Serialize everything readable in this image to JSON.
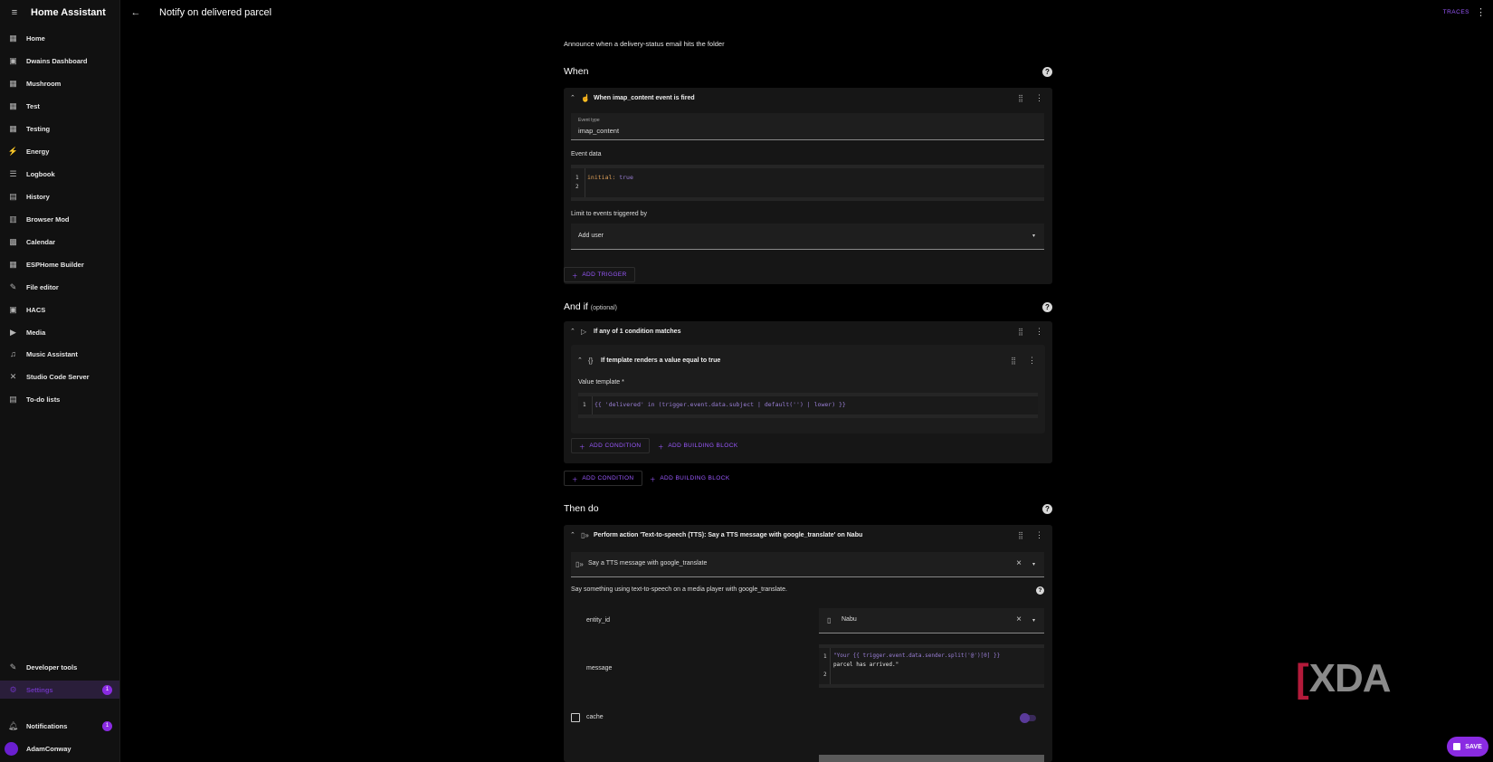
{
  "app": {
    "title": "Home Assistant"
  },
  "sidebar": {
    "items": [
      {
        "label": "Home",
        "icon": "grid-icon"
      },
      {
        "label": "Dwains Dashboard",
        "icon": "dashboard-icon"
      },
      {
        "label": "Mushroom",
        "icon": "grid-icon"
      },
      {
        "label": "Test",
        "icon": "grid-icon"
      },
      {
        "label": "Testing",
        "icon": "grid-icon"
      },
      {
        "label": "Energy",
        "icon": "lightning-icon"
      },
      {
        "label": "Logbook",
        "icon": "list-icon"
      },
      {
        "label": "History",
        "icon": "chart-icon"
      },
      {
        "label": "Browser Mod",
        "icon": "browser-icon"
      },
      {
        "label": "Calendar",
        "icon": "calendar-icon"
      },
      {
        "label": "ESPHome Builder",
        "icon": "esphome-icon"
      },
      {
        "label": "File editor",
        "icon": "wrench-icon"
      },
      {
        "label": "HACS",
        "icon": "hacs-icon"
      },
      {
        "label": "Media",
        "icon": "media-icon"
      },
      {
        "label": "Music Assistant",
        "icon": "music-icon"
      },
      {
        "label": "Studio Code Server",
        "icon": "vscode-icon"
      },
      {
        "label": "To-do lists",
        "icon": "clipboard-icon"
      }
    ],
    "developer_tools": "Developer tools",
    "settings": "Settings",
    "settings_badge": "1",
    "notifications": "Notifications",
    "notifications_badge": "1",
    "user": "AdamConway"
  },
  "topbar": {
    "title": "Notify on delivered parcel",
    "traces": "TRACES"
  },
  "automation": {
    "description": "Announce when a delivery-status email hits the folder",
    "when": {
      "title": "When",
      "trigger_header": "When imap_content event is fired",
      "event_type_label": "Event type",
      "event_type_value": "imap_content",
      "event_data_label": "Event data",
      "event_data_line1_key": "initial:",
      "event_data_line1_val": "true",
      "limit_label": "Limit to events triggered by",
      "add_user": "Add user",
      "add_trigger": "ADD TRIGGER"
    },
    "and_if": {
      "title": "And if",
      "optional": "(optional)",
      "condition_header": "If any of 1 condition matches",
      "template_header": "If template renders a value equal to true",
      "value_template_label": "Value template *",
      "template_code": "{{ 'delivered' in (trigger.event.data.subject | default('') | lower) }}",
      "inner_add_condition": "ADD CONDITION",
      "inner_add_building_block": "ADD BUILDING BLOCK",
      "add_condition": "ADD CONDITION",
      "add_building_block": "ADD BUILDING BLOCK"
    },
    "then_do": {
      "title": "Then do",
      "action_header": "Perform action 'Text-to-speech (TTS): Say a TTS message with google_translate' on Nabu",
      "action_select": "Say a TTS message with google_translate",
      "action_description": "Say something using text-to-speech on a media player with google_translate.",
      "entity_id_label": "entity_id",
      "entity_value": "Nabu",
      "message_label": "message",
      "message_line1": "\"Your {{ trigger.event.data.sender.split('@')[0] }}",
      "message_line1b": "parcel has arrived.\"",
      "cache_label": "cache"
    }
  },
  "save_label": "SAVE",
  "line_numbers": {
    "one": "1",
    "two": "2"
  },
  "watermark": {
    "bracket": "[",
    "text": "XDA"
  }
}
